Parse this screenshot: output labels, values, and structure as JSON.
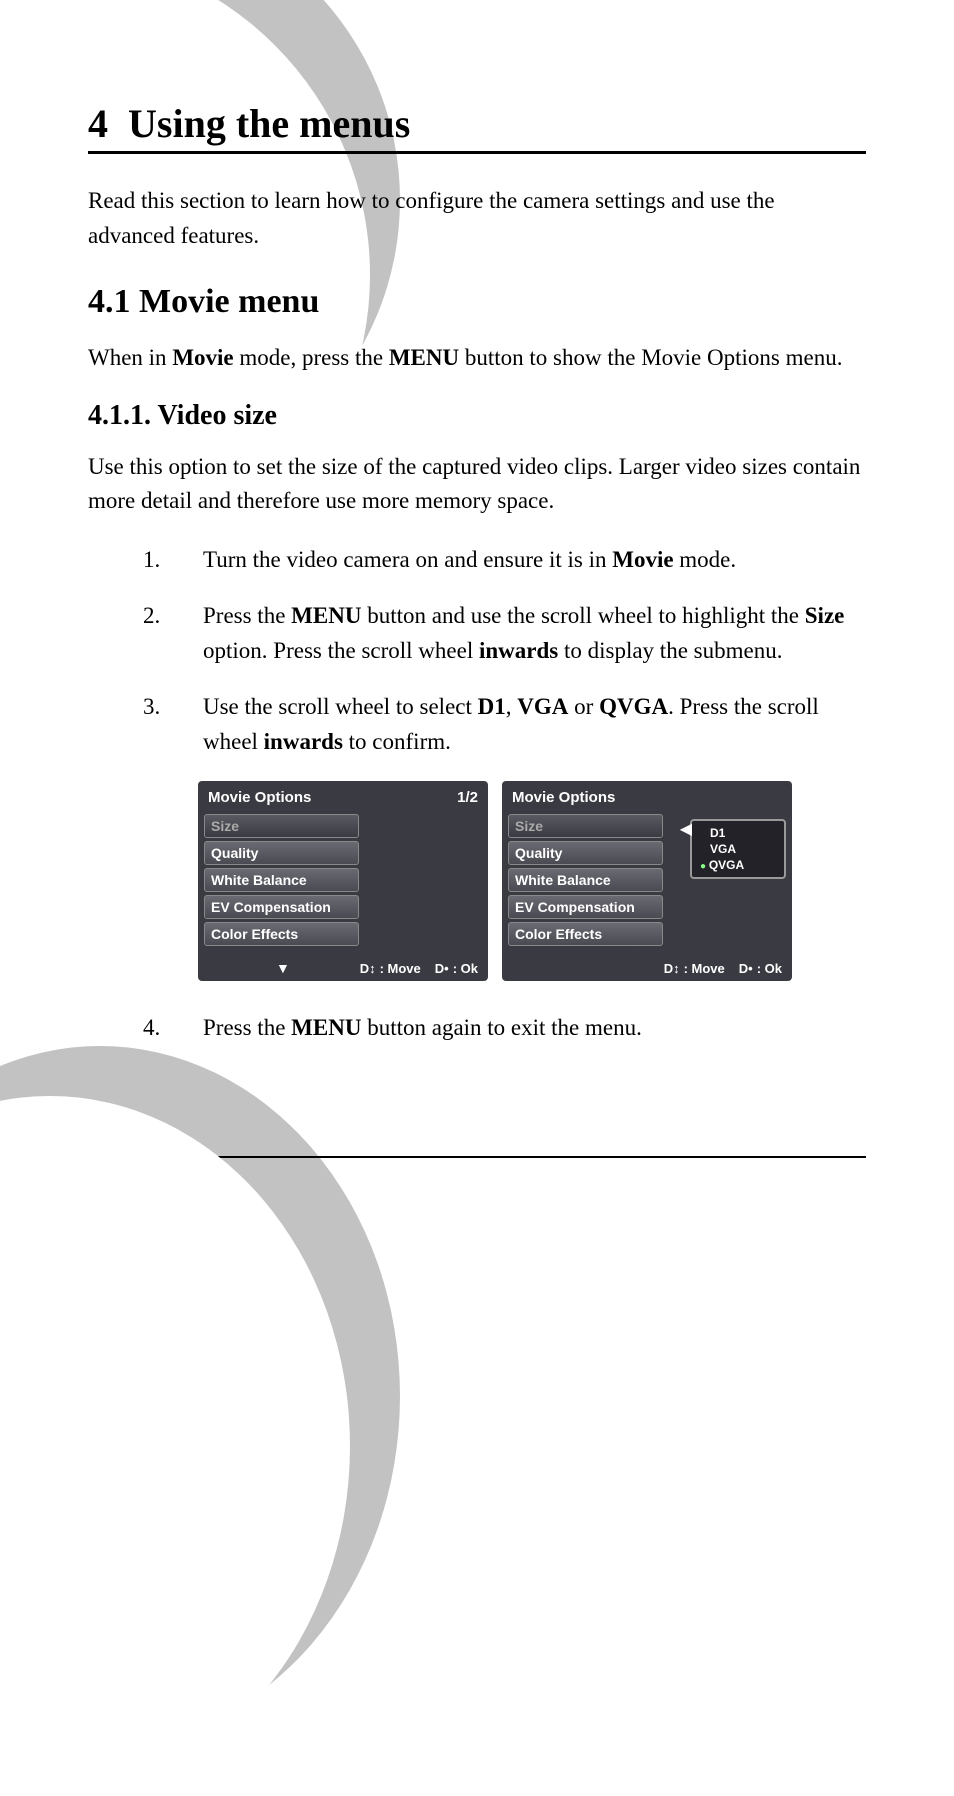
{
  "chapter": {
    "num": "4",
    "title": "Using the menus"
  },
  "intro": "Read this section to learn how to configure the camera settings and use the advanced features.",
  "s1": {
    "heading": "4.1 Movie menu",
    "text_pre": "When in ",
    "b1": "Movie",
    "text_mid": " mode, press the ",
    "b2": "MENU",
    "text_post": " button to show the Movie Options menu."
  },
  "s11": {
    "heading": "4.1.1. Video size",
    "body": "Use this option to set the size of the captured video clips. Larger video sizes contain more detail and therefore use more memory space.",
    "steps": {
      "1": {
        "n": "1.",
        "pre": "Turn the video camera on and ensure it is in ",
        "b1": "Movie",
        "post": " mode."
      },
      "2": {
        "n": "2.",
        "pre": "Press the ",
        "b1": "MENU",
        "mid1": " button and use the scroll wheel to highlight the ",
        "b2": "Size",
        "mid2": " option. Press the scroll wheel ",
        "b3": "inwards",
        "post": " to display the submenu."
      },
      "3": {
        "n": "3.",
        "pre": "Use the scroll wheel to select ",
        "b1": "D1",
        "c1": ", ",
        "b2": "VGA",
        "c2": " or ",
        "b3": "QVGA",
        "mid": ". Press the scroll wheel ",
        "b4": "inwards",
        "post": " to confirm."
      },
      "4": {
        "n": "4.",
        "pre": "Press the ",
        "b1": "MENU",
        "post": " button again to exit the menu."
      }
    }
  },
  "screen_left": {
    "title": "Movie Options",
    "page": "1/2",
    "items": [
      "Size",
      "Quality",
      "White Balance",
      "EV Compensation",
      "Color Effects"
    ],
    "move": ": Move",
    "ok": ": Ok"
  },
  "screen_right": {
    "title": "Movie Options",
    "items": [
      "Size",
      "Quality",
      "White Balance",
      "EV Compensation",
      "Color Effects"
    ],
    "popup": [
      "D1",
      "VGA",
      "QVGA"
    ],
    "move": ": Move",
    "ok": ": Ok"
  }
}
